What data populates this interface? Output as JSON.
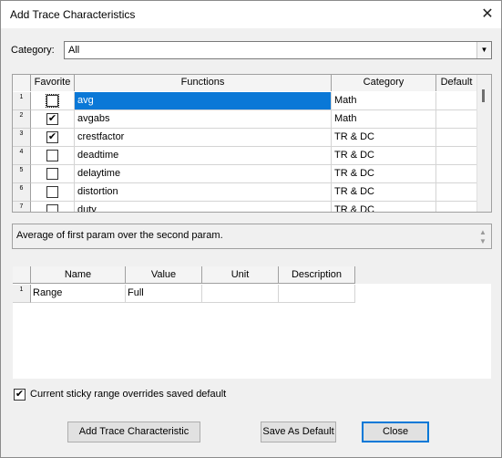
{
  "window": {
    "title": "Add Trace Characteristics"
  },
  "category": {
    "label": "Category:",
    "value": "All"
  },
  "functions_grid": {
    "columns": [
      "Favorite",
      "Functions",
      "Category",
      "Default"
    ],
    "rows": [
      {
        "num": "1",
        "favorite": false,
        "function": "avg",
        "category": "Math",
        "default": "",
        "selected": true
      },
      {
        "num": "2",
        "favorite": true,
        "function": "avgabs",
        "category": "Math",
        "default": ""
      },
      {
        "num": "3",
        "favorite": true,
        "function": "crestfactor",
        "category": "TR & DC",
        "default": ""
      },
      {
        "num": "4",
        "favorite": false,
        "function": "deadtime",
        "category": "TR & DC",
        "default": ""
      },
      {
        "num": "5",
        "favorite": false,
        "function": "delaytime",
        "category": "TR & DC",
        "default": ""
      },
      {
        "num": "6",
        "favorite": false,
        "function": "distortion",
        "category": "TR & DC",
        "default": ""
      },
      {
        "num": "7",
        "favorite": false,
        "function": "duty",
        "category": "TR & DC",
        "default": ""
      }
    ]
  },
  "description": {
    "text": "Average of first param over the second param."
  },
  "params_grid": {
    "columns": [
      "Name",
      "Value",
      "Unit",
      "Description"
    ],
    "rows": [
      {
        "num": "1",
        "name": "Range",
        "value": "Full",
        "unit": "",
        "description": ""
      }
    ]
  },
  "sticky": {
    "label": "Current sticky range overrides saved default",
    "checked": true
  },
  "buttons": {
    "add": "Add Trace Characteristic",
    "save_default": "Save As Default",
    "close": "Close"
  },
  "icons": {
    "close": "close-icon",
    "dropdown": "chevron-down-icon",
    "check": "checkmark-icon"
  },
  "colors": {
    "selection": "#0a78d7",
    "default_button_border": "#0078d7"
  }
}
